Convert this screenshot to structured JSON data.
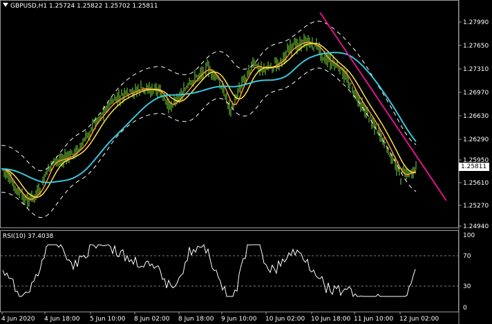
{
  "header": {
    "symbol": "GBPUSD,H1",
    "open": "1.25724",
    "high": "1.25822",
    "low": "1.25702",
    "close": "1.25811"
  },
  "price_axis": {
    "labels": [
      "1.27990",
      "1.27650",
      "1.27310",
      "1.26970",
      "1.26630",
      "1.26290",
      "1.25950",
      "1.25610",
      "1.25270",
      "1.24940"
    ],
    "current": "1.25811"
  },
  "rsi": {
    "label": "RSI(10) 37.4038",
    "levels": [
      "100",
      "70",
      "30",
      "0"
    ]
  },
  "time_axis": {
    "labels": [
      "4 Jun 2020",
      "4 Jun 18:00",
      "5 Jun 10:00",
      "8 Jun 02:00",
      "8 Jun 18:00",
      "9 Jun 10:00",
      "10 Jun 02:00",
      "10 Jun 18:00",
      "11 Jun 10:00",
      "12 Jun 02:00"
    ]
  },
  "colors": {
    "background": "#000000",
    "candles": "#7cdc3c",
    "ma_fast": "#ff9a2e",
    "ma_mid": "#ffe34a",
    "ma_slow": "#38c8e0",
    "bands": "#ffffff",
    "trendline": "#e0158a",
    "grid": "#808080"
  }
}
